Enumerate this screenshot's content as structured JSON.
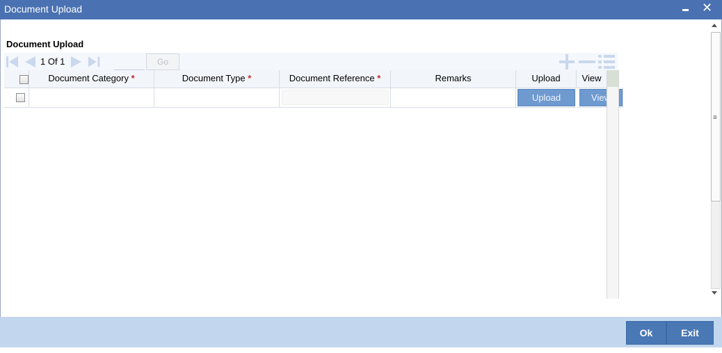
{
  "window": {
    "title": "Document Upload",
    "minimize_icon": "minimize-icon",
    "close_icon": "close-icon"
  },
  "section": {
    "title": "Document Upload"
  },
  "pagination": {
    "page_text": "1 Of 1",
    "page_input_value": "",
    "go_label": "Go",
    "icons": [
      "first-page-icon",
      "previous-page-icon",
      "next-page-icon",
      "last-page-icon"
    ]
  },
  "toolbar": {
    "icons": [
      "add-row-icon",
      "delete-row-icon",
      "single-view-icon"
    ]
  },
  "grid": {
    "columns": [
      {
        "label": "Document Category",
        "required": true
      },
      {
        "label": "Document Type",
        "required": true
      },
      {
        "label": "Document Reference",
        "required": true
      },
      {
        "label": "Remarks",
        "required": false
      },
      {
        "label": "Upload",
        "required": false
      },
      {
        "label": "View",
        "required": false
      }
    ],
    "required_marker": "*",
    "rows": [
      {
        "document_category": "",
        "document_type": "",
        "document_reference": "",
        "remarks": "",
        "upload_label": "Upload",
        "view_label": "View"
      }
    ]
  },
  "footer": {
    "ok_label": "Ok",
    "exit_label": "Exit"
  },
  "colors": {
    "title_bar": "#4a72b2",
    "footer_bar": "#c2d7ee",
    "primary_button": "#4978b5",
    "row_button": "#6e9ad0",
    "required_marker": "#c0302e"
  }
}
